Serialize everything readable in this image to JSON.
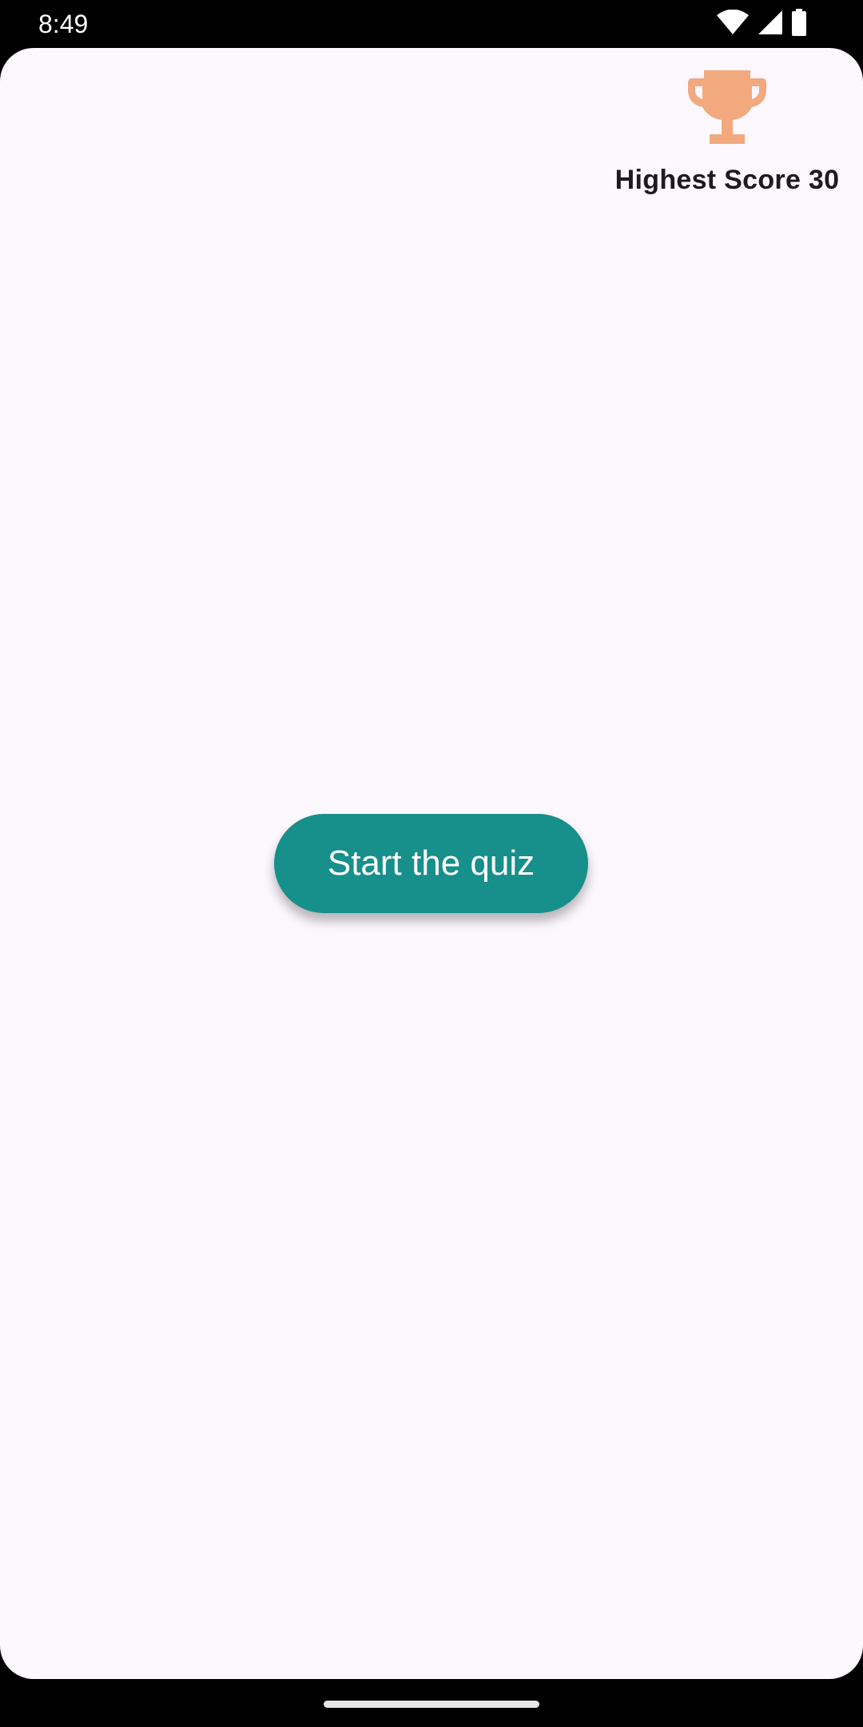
{
  "status_bar": {
    "time": "8:49",
    "icons": [
      "wifi-icon",
      "signal-icon",
      "battery-icon"
    ]
  },
  "score": {
    "icon": "trophy-icon",
    "icon_color": "#f2a97e",
    "label": "Highest Score 30"
  },
  "main": {
    "start_button_label": "Start the quiz",
    "button_color": "#178f8a"
  },
  "colors": {
    "background": "#fdf7fe",
    "text": "#1d1b20"
  }
}
